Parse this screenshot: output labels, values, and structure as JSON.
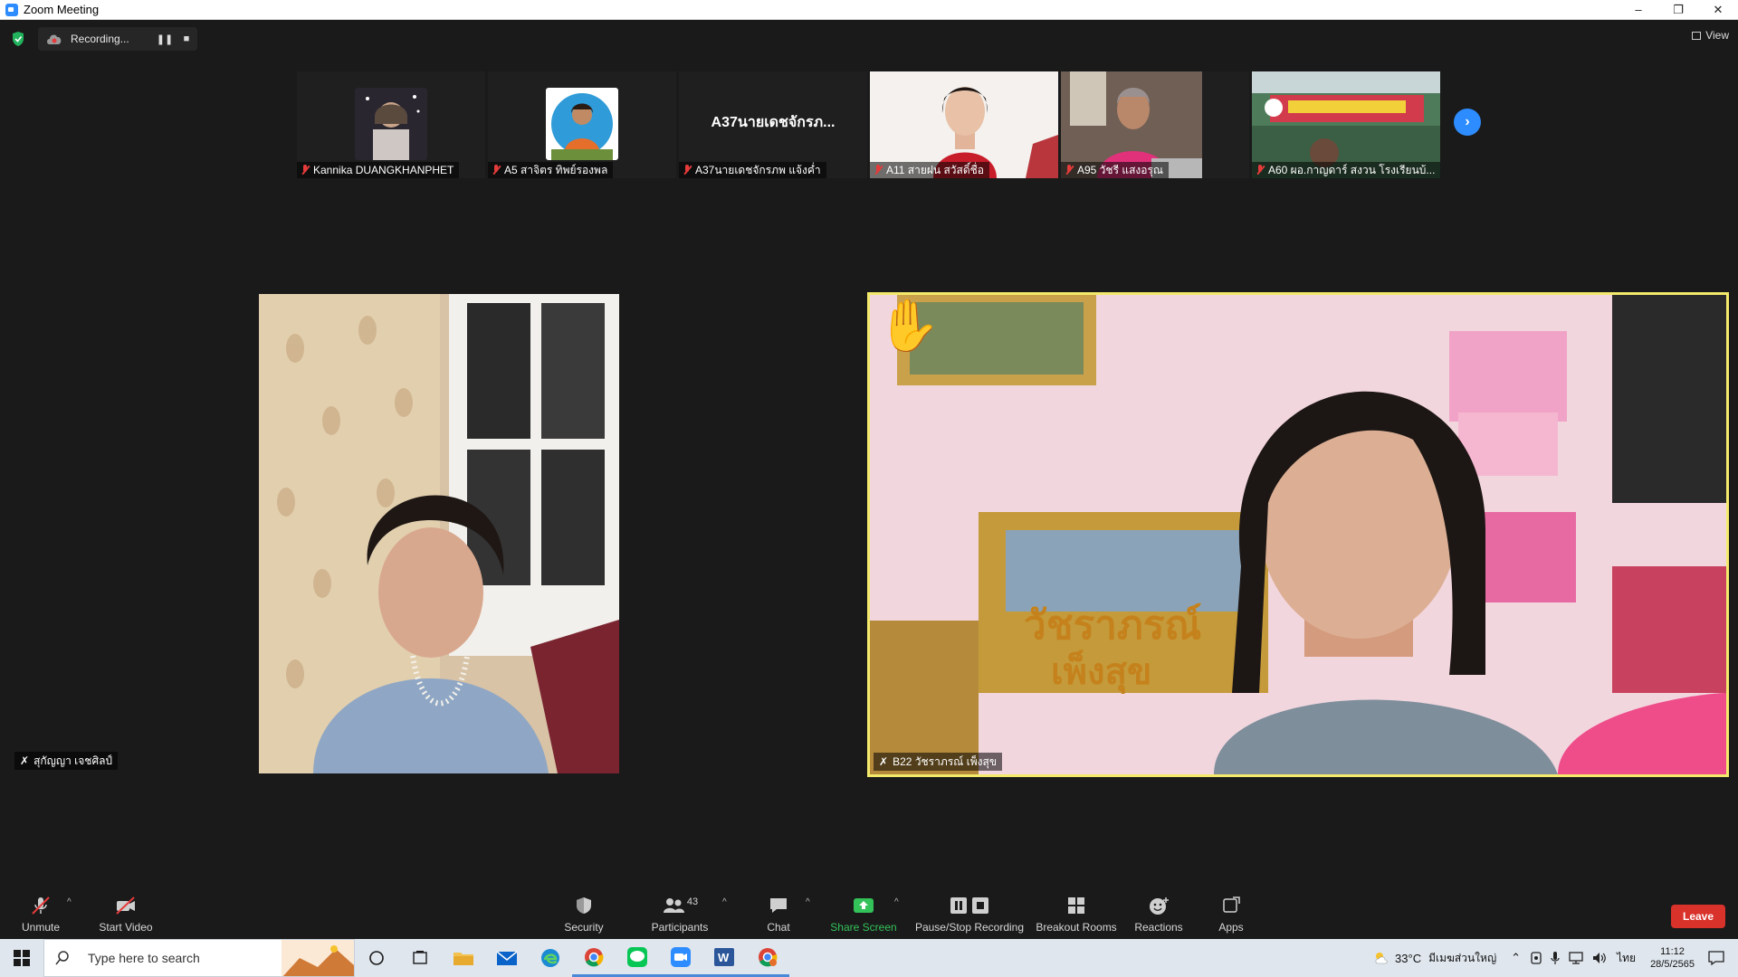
{
  "window": {
    "title": "Zoom Meeting",
    "minimize": "–",
    "restore": "❐",
    "close": "✕"
  },
  "recording": {
    "label": "Recording...",
    "pause": "❚❚",
    "stop": "■"
  },
  "view_label": "View",
  "thumbnails": [
    {
      "name": "Kannika DUANGKHANPHET"
    },
    {
      "name": "A5 สาจิตร ทิพย์รองพล"
    },
    {
      "name": "A37นายเดชจักรภพ แจ้งค่ำ",
      "display_name": "A37นายเดชจักรภ..."
    },
    {
      "name": "A11 สายฝน สวัสดิ์ชื่อ"
    },
    {
      "name": "A95 วัชรี แสงอรุณ"
    },
    {
      "name": "A60 ผอ.กาญดาร์ สงวน โรงเรียนบ้..."
    }
  ],
  "next_arrow": "›",
  "main_videos": {
    "left": {
      "name": "สุกัญญา เจชศิลป์"
    },
    "right": {
      "name": "B22 วัชราภรณ์ เพ็งสุข",
      "hand": "✋"
    }
  },
  "toolbar": {
    "unmute": "Unmute",
    "start_video": "Start Video",
    "security": "Security",
    "participants": "Participants",
    "participants_count": "43",
    "chat": "Chat",
    "share_screen": "Share Screen",
    "pause_stop_recording": "Pause/Stop Recording",
    "breakout_rooms": "Breakout Rooms",
    "reactions": "Reactions",
    "apps": "Apps",
    "leave": "Leave",
    "caret": "^"
  },
  "taskbar": {
    "search_placeholder": "Type here to search",
    "weather": "33°C",
    "weather_desc": "มีเมฆส่วนใหญ่",
    "language": "ไทย",
    "time": "11:12",
    "date": "28/5/2565"
  },
  "colors": {
    "accent_blue": "#2d8cff",
    "active_speaker": "#f3e96b",
    "leave_red": "#d9322b",
    "share_green": "#33c159"
  }
}
